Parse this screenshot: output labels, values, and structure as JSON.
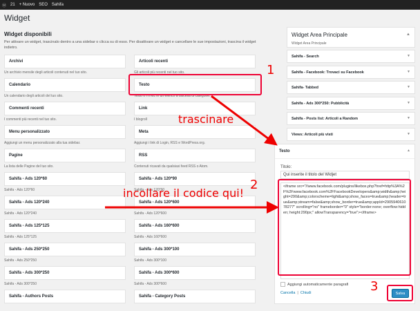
{
  "adminbar": {
    "wp_icon": "wordpress-icon",
    "count": "21",
    "new": "+ Nuovo",
    "seo": "SEO",
    "site": "Sahifa"
  },
  "page": {
    "title": "Widget",
    "available_title": "Widget disponibili",
    "intro": "Per attivare un widget, trascinalo dentro a una sidebar o clicca su di esso. Per disattivare un widget e cancellare le sue impostazioni, trascina il widget indietro."
  },
  "col1": [
    {
      "name": "Archivi",
      "desc": "Un archivio mensile degli articoli contenuti nel tuo sito."
    },
    {
      "name": "Calendario",
      "desc": "Un calendario degli articoli del tuo sito."
    },
    {
      "name": "Commenti recenti",
      "desc": "I commenti più recenti nel tuo sito."
    },
    {
      "name": "Menu personalizzato",
      "desc": "Aggiungi un menu personalizzato alla tua sidebar."
    },
    {
      "name": "Pagine",
      "desc": "La lista delle Pagine del tuo sito."
    },
    {
      "name": "Sahifa - Ads 120*60",
      "desc": "Sahifa - Ads 120*60"
    },
    {
      "name": "Sahifa - Ads 120*240",
      "desc": "Sahifa - Ads 120*240"
    },
    {
      "name": "Sahifa - Ads 125*125",
      "desc": "Sahifa - Ads 125*125"
    },
    {
      "name": "Sahifa - Ads 250*250",
      "desc": "Sahifa - Ads 250*250"
    },
    {
      "name": "Sahifa - Ads 300*250",
      "desc": "Sahifa - Ads 300*250"
    },
    {
      "name": "Sahifa - Authors Posts",
      "desc": ""
    }
  ],
  "col2": [
    {
      "name": "Articoli recenti",
      "desc": "Gli articoli più recenti nel tuo sito."
    },
    {
      "name": "Testo",
      "desc": "Testo o HTML in un elenco a discesa di categorie."
    },
    {
      "name": "Link",
      "desc": "I blogroll"
    },
    {
      "name": "Meta",
      "desc": "Aggiungi i link di Login, RSS e WordPress.org."
    },
    {
      "name": "RSS",
      "desc": "Contenuti ricavati da qualsiasi feed RSS o Atom."
    },
    {
      "name": "Sahifa - Ads 120*90",
      "desc": "Sahifa - Ads 120*90"
    },
    {
      "name": "Sahifa - Ads 120*600",
      "desc": "Sahifa - Ads 120*600"
    },
    {
      "name": "Sahifa - Ads 160*600",
      "desc": "Sahifa - Ads 160*600"
    },
    {
      "name": "Sahifa - Ads 300*100",
      "desc": "Sahifa - Ads 300*100"
    },
    {
      "name": "Sahifa - Ads 300*600",
      "desc": "Sahifa - Ads 300*600"
    },
    {
      "name": "Sahifa - Category Posts",
      "desc": ""
    }
  ],
  "area": {
    "title": "Widget Area Principale",
    "desc": "Widget Area Principale"
  },
  "area_widgets": [
    "Sahifa - Search",
    "Sahifa - Facebook: Trovaci su Facebook",
    "Sahifa- Tabbed",
    "Sahifa - Ads 300*250: Pubblicità",
    "Sahifa - Posts list: Articoli a Random",
    "Views: Articoli più visti"
  ],
  "text_widget": {
    "header": "Testo",
    "title_label": "Titolo:",
    "title_value": "Qui inserite il titolo del Widjet",
    "code": "<iframe src=\"//www.facebook.com/plugins/likebox.php?href=http%3A%2F%2Fwww.facebook.com%2FFacebookDevelopers&amp;width&amp;height=290&amp;colorscheme=light&amp;show_faces=true&amp;header=true&amp;stream=false&amp;show_border=true&amp;appId=290594061078277\" scrolling=\"no\" frameborder=\"0\" style=\"border:none; overflow:hidden; height:290px;\" allowTransparency=\"true\"></iframe>",
    "autop": "Aggiungi automaticamente paragrafi",
    "delete": "Cancella",
    "sep": "|",
    "close": "Chiudi",
    "save": "Salva"
  },
  "annotations": {
    "n1": "1",
    "n2": "2",
    "n3": "3",
    "drag": "trascinare",
    "paste": "incollare il codice qui!"
  },
  "colors": {
    "highlight": "#e00000",
    "primary_button": "#2e8ec5"
  }
}
